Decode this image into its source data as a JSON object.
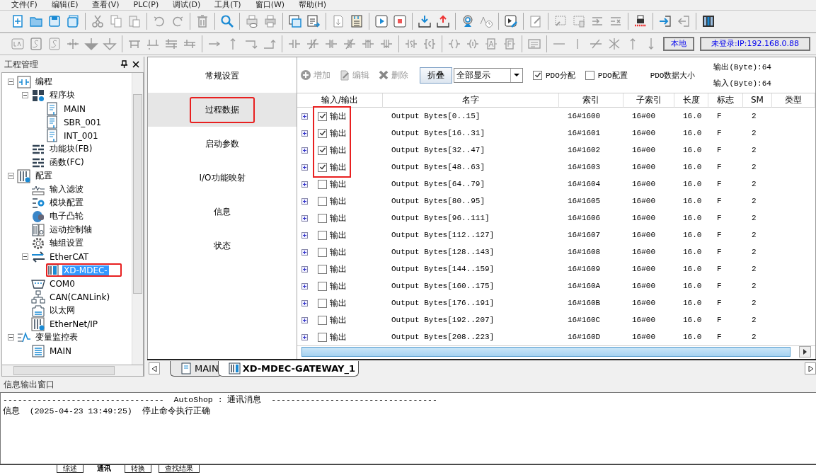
{
  "menu": [
    "文件(F)",
    "编辑(E)",
    "查看(V)",
    "PLC(P)",
    "调试(D)",
    "工具(T)",
    "窗口(W)",
    "帮助(H)"
  ],
  "connection": {
    "location": "本地",
    "login": "未登录:IP:192.168.0.88"
  },
  "project_panel": {
    "title": "工程管理",
    "tree": [
      {
        "label": "编程",
        "kind": "program",
        "expanded": true,
        "selected": false,
        "annotated": false,
        "children": [
          {
            "label": "程序块",
            "kind": "blocks",
            "expanded": true,
            "selected": false,
            "annotated": false,
            "children": [
              {
                "label": "MAIN",
                "kind": "doc",
                "selected": false,
                "annotated": false
              },
              {
                "label": "SBR_001",
                "kind": "doc",
                "selected": false,
                "annotated": false
              },
              {
                "label": "INT_001",
                "kind": "doc",
                "selected": false,
                "annotated": false
              }
            ]
          },
          {
            "label": "功能块(FB)",
            "kind": "list",
            "selected": false,
            "annotated": false
          },
          {
            "label": "函数(FC)",
            "kind": "list",
            "selected": false,
            "annotated": false
          }
        ]
      },
      {
        "label": "配置",
        "kind": "config",
        "expanded": true,
        "selected": false,
        "annotated": false,
        "children": [
          {
            "label": "输入滤波",
            "kind": "wave",
            "selected": false,
            "annotated": false
          },
          {
            "label": "模块配置",
            "kind": "gearlist",
            "selected": false,
            "annotated": false
          },
          {
            "label": "电子凸轮",
            "kind": "cam",
            "selected": false,
            "annotated": false
          },
          {
            "label": "运动控制轴",
            "kind": "axis",
            "selected": false,
            "annotated": false
          },
          {
            "label": "轴组设置",
            "kind": "gear",
            "selected": false,
            "annotated": false
          },
          {
            "label": "EtherCAT",
            "kind": "arrows",
            "expanded": true,
            "selected": false,
            "annotated": false,
            "children": [
              {
                "label": "XD-MDEC-",
                "kind": "module",
                "selected": true,
                "annotated": true
              }
            ]
          },
          {
            "label": "COM0",
            "kind": "port",
            "selected": false,
            "annotated": false
          },
          {
            "label": "CAN(CANLink)",
            "kind": "network",
            "selected": false,
            "annotated": false
          },
          {
            "label": "以太网",
            "kind": "ethernet",
            "selected": false,
            "annotated": false
          },
          {
            "label": "EtherNet/IP",
            "kind": "config",
            "selected": false,
            "annotated": false
          }
        ]
      },
      {
        "label": "变量监控表",
        "kind": "monitor",
        "expanded": true,
        "selected": false,
        "annotated": false,
        "children": [
          {
            "label": "MAIN",
            "kind": "table",
            "selected": false,
            "annotated": false
          }
        ]
      }
    ]
  },
  "editor": {
    "nav": [
      {
        "label": "常规设置",
        "selected": false,
        "annotated": false
      },
      {
        "label": "过程数据",
        "selected": true,
        "annotated": true
      },
      {
        "label": "启动参数",
        "selected": false,
        "annotated": false
      },
      {
        "label": "I/O功能映射",
        "selected": false,
        "annotated": false
      },
      {
        "label": "信息",
        "selected": false,
        "annotated": false
      },
      {
        "label": "状态",
        "selected": false,
        "annotated": false
      }
    ],
    "actions": [
      {
        "label": "增加",
        "kind": "add",
        "disabled": true
      },
      {
        "label": "编辑",
        "kind": "edit",
        "disabled": true
      },
      {
        "label": "删除",
        "kind": "delete",
        "disabled": true
      }
    ],
    "collapse_button": "折叠",
    "filter": {
      "value": "全部显示"
    },
    "options": [
      {
        "label": "PDO分配",
        "checked": true
      },
      {
        "label": "PDO配置",
        "checked": false
      }
    ],
    "size_label": "PDO数据大小",
    "output_size": "输出(Byte):64",
    "input_size": "输入(Byte):64",
    "columns": [
      "输入/输出",
      "名字",
      "索引",
      "子索引",
      "长度",
      "标志",
      "SM",
      "类型"
    ],
    "rows": [
      {
        "checked": true,
        "annotated": true,
        "io": "输出",
        "name": "Output Bytes[0..15]",
        "index": "16#1600",
        "subindex": "16#00",
        "length": "16.0",
        "flag": "F",
        "sm": "2"
      },
      {
        "checked": true,
        "annotated": true,
        "io": "输出",
        "name": "Output Bytes[16..31]",
        "index": "16#1601",
        "subindex": "16#00",
        "length": "16.0",
        "flag": "F",
        "sm": "2"
      },
      {
        "checked": true,
        "annotated": true,
        "io": "输出",
        "name": "Output Bytes[32..47]",
        "index": "16#1602",
        "subindex": "16#00",
        "length": "16.0",
        "flag": "F",
        "sm": "2"
      },
      {
        "checked": true,
        "annotated": true,
        "io": "输出",
        "name": "Output Bytes[48..63]",
        "index": "16#1603",
        "subindex": "16#00",
        "length": "16.0",
        "flag": "F",
        "sm": "2"
      },
      {
        "checked": false,
        "annotated": false,
        "io": "输出",
        "name": "Output Bytes[64..79]",
        "index": "16#1604",
        "subindex": "16#00",
        "length": "16.0",
        "flag": "F",
        "sm": "2"
      },
      {
        "checked": false,
        "annotated": false,
        "io": "输出",
        "name": "Output Bytes[80..95]",
        "index": "16#1605",
        "subindex": "16#00",
        "length": "16.0",
        "flag": "F",
        "sm": "2"
      },
      {
        "checked": false,
        "annotated": false,
        "io": "输出",
        "name": "Output Bytes[96..111]",
        "index": "16#1606",
        "subindex": "16#00",
        "length": "16.0",
        "flag": "F",
        "sm": "2"
      },
      {
        "checked": false,
        "annotated": false,
        "io": "输出",
        "name": "Output Bytes[112..127]",
        "index": "16#1607",
        "subindex": "16#00",
        "length": "16.0",
        "flag": "F",
        "sm": "2"
      },
      {
        "checked": false,
        "annotated": false,
        "io": "输出",
        "name": "Output Bytes[128..143]",
        "index": "16#1608",
        "subindex": "16#00",
        "length": "16.0",
        "flag": "F",
        "sm": "2"
      },
      {
        "checked": false,
        "annotated": false,
        "io": "输出",
        "name": "Output Bytes[144..159]",
        "index": "16#1609",
        "subindex": "16#00",
        "length": "16.0",
        "flag": "F",
        "sm": "2"
      },
      {
        "checked": false,
        "annotated": false,
        "io": "输出",
        "name": "Output Bytes[160..175]",
        "index": "16#160A",
        "subindex": "16#00",
        "length": "16.0",
        "flag": "F",
        "sm": "2"
      },
      {
        "checked": false,
        "annotated": false,
        "io": "输出",
        "name": "Output Bytes[176..191]",
        "index": "16#160B",
        "subindex": "16#00",
        "length": "16.0",
        "flag": "F",
        "sm": "2"
      },
      {
        "checked": false,
        "annotated": false,
        "io": "输出",
        "name": "Output Bytes[192..207]",
        "index": "16#160C",
        "subindex": "16#00",
        "length": "16.0",
        "flag": "F",
        "sm": "2"
      },
      {
        "checked": false,
        "annotated": false,
        "io": "输出",
        "name": "Output Bytes[208..223]",
        "index": "16#160D",
        "subindex": "16#00",
        "length": "16.0",
        "flag": "F",
        "sm": "2"
      }
    ]
  },
  "editor_tabs": [
    {
      "label": "MAIN",
      "kind": "doc",
      "selected": false
    },
    {
      "label": "XD-MDEC-GATEWAY_1",
      "kind": "module",
      "selected": true
    }
  ],
  "output_panel": {
    "title": "信息输出窗口",
    "lines": [
      "---------------------------------  AutoShop : 通讯消息  ----------------------------------",
      "信息  (2025-04-23 13:49:25)  停止命令执行正确"
    ],
    "tabs": [
      {
        "label": "综述",
        "selected": false
      },
      {
        "label": "通讯",
        "selected": true
      },
      {
        "label": "转换",
        "selected": false
      },
      {
        "label": "查找结果",
        "selected": false
      }
    ]
  }
}
